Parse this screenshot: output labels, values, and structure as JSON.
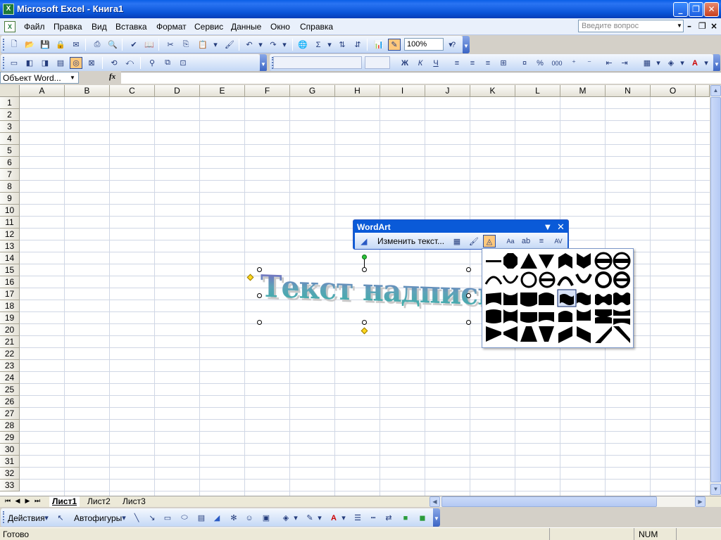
{
  "window": {
    "title": "Microsoft Excel - Книга1"
  },
  "menu": {
    "items": [
      "Файл",
      "Правка",
      "Вид",
      "Вставка",
      "Формат",
      "Сервис",
      "Данные",
      "Окно",
      "Справка"
    ],
    "ask_placeholder": "Введите вопрос"
  },
  "toolbar": {
    "zoom": "100%"
  },
  "formula_bar": {
    "name_box": "Объект Word...",
    "fx": "fx",
    "formula": ""
  },
  "grid": {
    "columns": [
      "A",
      "B",
      "C",
      "D",
      "E",
      "F",
      "G",
      "H",
      "I",
      "J",
      "K",
      "L",
      "M",
      "N",
      "O"
    ],
    "rows": [
      "1",
      "2",
      "3",
      "4",
      "5",
      "6",
      "7",
      "8",
      "9",
      "10",
      "11",
      "12",
      "13",
      "14",
      "15",
      "16",
      "17",
      "18",
      "19",
      "20",
      "21",
      "22",
      "23",
      "24",
      "25",
      "26",
      "27",
      "28",
      "29",
      "30",
      "31",
      "32",
      "33"
    ]
  },
  "wordart_object": {
    "text": "Текст надписи"
  },
  "wordart_toolbar": {
    "title": "WordArt",
    "edit_text_label": "Изменить текст..."
  },
  "sheets": {
    "tabs": [
      "Лист1",
      "Лист2",
      "Лист3"
    ],
    "active": "Лист1"
  },
  "drawing": {
    "actions_label": "Действия",
    "autoshapes_label": "Автофигуры"
  },
  "status": {
    "text": "Готово",
    "num": "NUM"
  },
  "colors": {
    "title_blue": "#0a5fe6",
    "grid_line": "#d0d7e5",
    "wordart_start": "#7b5fc4",
    "wordart_end": "#36b0a6"
  }
}
